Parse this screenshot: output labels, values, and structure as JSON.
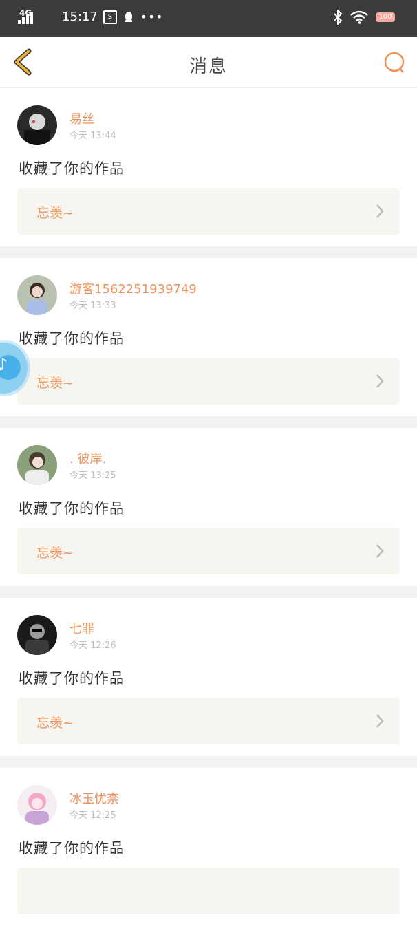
{
  "status_bar": {
    "network": "4G",
    "hd": "HD",
    "time": "15:17",
    "battery": "100"
  },
  "header": {
    "title": "消息"
  },
  "messages": [
    {
      "username": "易丝",
      "time": "今天 13:44",
      "action": "收藏了你的作品",
      "work_title": "忘羡~"
    },
    {
      "username": "游客1562251939749",
      "time": "今天 13:33",
      "action": "收藏了你的作品",
      "work_title": "忘羡~"
    },
    {
      "username": ". 彼岸.",
      "time": "今天 13:25",
      "action": "收藏了你的作品",
      "work_title": "忘羡~"
    },
    {
      "username": "七罪",
      "time": "今天 12:26",
      "action": "收藏了你的作品",
      "work_title": "忘羡~"
    },
    {
      "username": "冰玉忧柰",
      "time": "今天 12:25",
      "action": "收藏了你的作品",
      "work_title": ""
    }
  ],
  "colors": {
    "accent": "#f0935a",
    "back_arrow": "#e8b33a",
    "card_bg": "#f7f5ef",
    "separator": "#f2f2f2"
  }
}
